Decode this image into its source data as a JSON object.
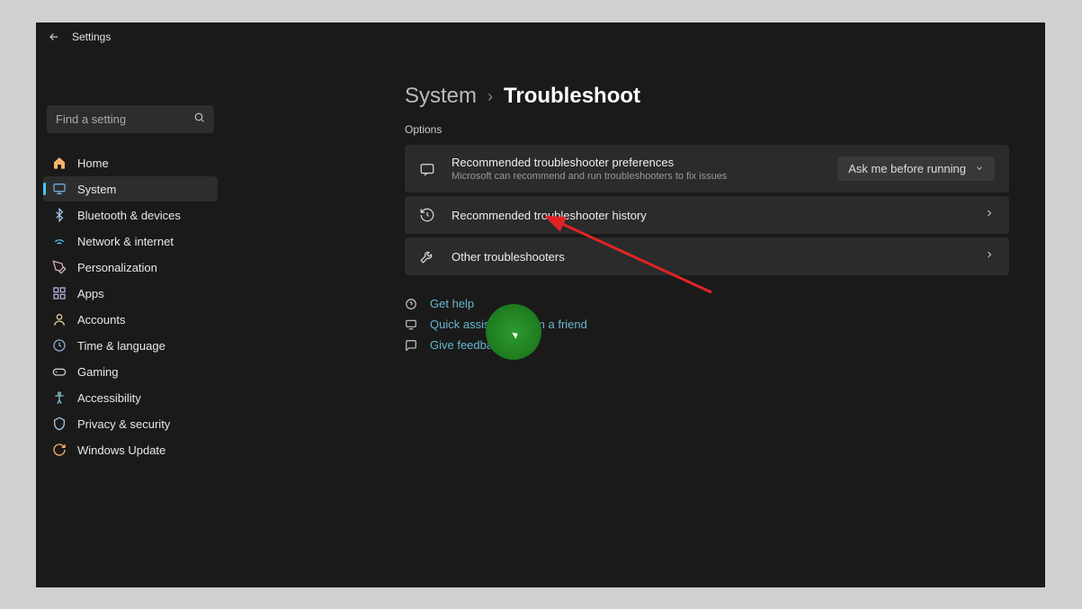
{
  "titlebar": {
    "title": "Settings"
  },
  "search": {
    "placeholder": "Find a setting"
  },
  "nav": [
    {
      "label": "Home"
    },
    {
      "label": "System"
    },
    {
      "label": "Bluetooth & devices"
    },
    {
      "label": "Network & internet"
    },
    {
      "label": "Personalization"
    },
    {
      "label": "Apps"
    },
    {
      "label": "Accounts"
    },
    {
      "label": "Time & language"
    },
    {
      "label": "Gaming"
    },
    {
      "label": "Accessibility"
    },
    {
      "label": "Privacy & security"
    },
    {
      "label": "Windows Update"
    }
  ],
  "breadcrumb": {
    "parent": "System",
    "current": "Troubleshoot"
  },
  "section_label": "Options",
  "cards": {
    "preferences": {
      "title": "Recommended troubleshooter preferences",
      "subtitle": "Microsoft can recommend and run troubleshooters to fix issues",
      "selected": "Ask me before running"
    },
    "history": {
      "title": "Recommended troubleshooter history"
    },
    "other": {
      "title": "Other troubleshooters"
    }
  },
  "links": {
    "help": "Get help",
    "quick": "Quick assistance from a friend",
    "feedback": "Give feedback"
  }
}
